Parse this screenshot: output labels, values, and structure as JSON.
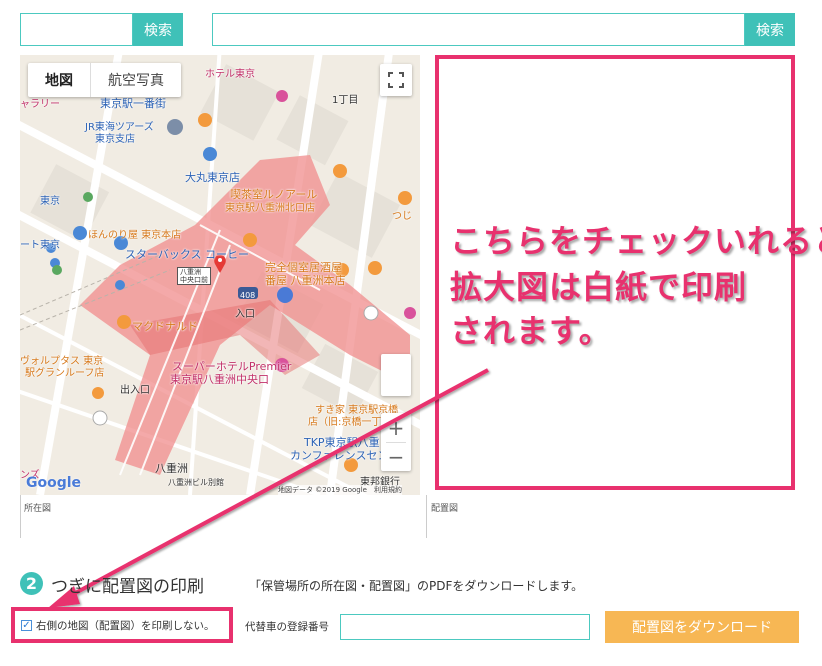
{
  "search": {
    "left_button": "検索",
    "right_button": "検索",
    "left_value": "",
    "right_value": ""
  },
  "map": {
    "tabs": [
      "地図",
      "航空写真"
    ],
    "zoom_in": "+",
    "zoom_out": "−",
    "fullscreen_icon": "fullscreen-icon",
    "google_logo": "Google",
    "attribution": "地図データ ©2019 Google　利用規約",
    "marker_label": [
      "八重洲",
      "中央口前"
    ],
    "labels": {
      "ichibankan": "東京駅一番街",
      "jr_tokai_1": "JR東海ツアーズ",
      "jr_tokai_2": "東京支店",
      "daimaru": "大丸東京店",
      "kissa_1": "喫茶室ルノアール",
      "kissa_2": "東京駅八重洲北口店",
      "tokyo": "東京",
      "honnori": "ほんのり屋 東京本店",
      "starbucks": "スターバックス コーヒー",
      "kanzen_1": "完全個室居酒屋",
      "kanzen_2": "番屋 八重洲本店",
      "mcdonalds": "マクドナルド",
      "super_hotel_1": "スーパーホテルPremier",
      "super_hotel_2": "東京駅八重洲中央口",
      "sukiya_1": "すき家 東京駅京橋",
      "sukiya_2": "店（旧:京橋一丁目",
      "tkp_1": "TKP東京駅八重",
      "tkp_2": "カンファレンスセンター",
      "yaesu": "八重洲",
      "yaesu_building": "八重洲ビル別館",
      "deguchi": "出入口",
      "iriguchi": "入口",
      "chome": "1丁目",
      "hotel": "ホテル東京",
      "galerie": "ャラリー",
      "waltz_1": "ヴォルプタス 東京",
      "waltz_2": "駅グランルーフ店",
      "tokyo_ekimae": "ート東京",
      "route": "408",
      "tsuji": "つじ",
      "tohoku": "東邦銀行",
      "denki": "ンズ"
    }
  },
  "captions": {
    "location": "所在図",
    "layout": "配置図"
  },
  "callout": {
    "lines": [
      "こちらをチェックいれると",
      "拡大図は白紙で印刷",
      "されます。"
    ]
  },
  "step": {
    "number": "2",
    "title": "つぎに配置図の印刷",
    "description": "「保管場所の所在図・配置図」のPDFをダウンロードします。"
  },
  "form": {
    "checkbox_label": "右側の地図（配置図）を印刷しない。",
    "checkbox_checked": true,
    "registration_label": "代替車の登録番号",
    "registration_value": "",
    "download_button": "配置図をダウンロード"
  },
  "colors": {
    "accent": "#3fc1b8",
    "highlight": "#e8316e",
    "download": "#f7b754"
  }
}
